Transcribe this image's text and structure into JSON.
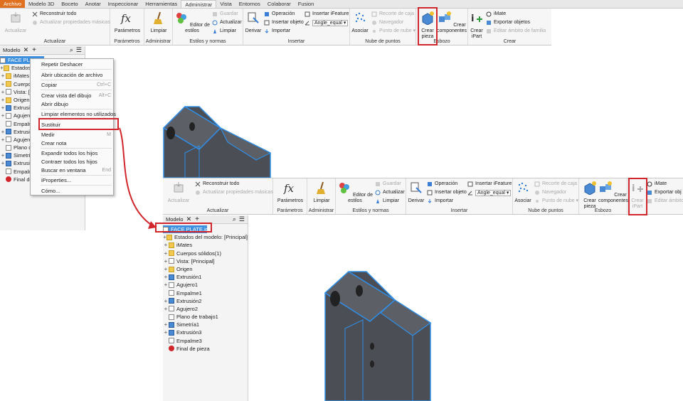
{
  "tabs": [
    "Archivo",
    "Modelo 3D",
    "Boceto",
    "Anotar",
    "Inspeccionar",
    "Herramientas",
    "Administrar",
    "Vista",
    "Entornos",
    "Colaborar",
    "Fusion"
  ],
  "top_ribbon": {
    "actualizar": "Actualizar",
    "reconstruir": "Reconstruir todo",
    "act_props": "Actualizar propiedades másicas",
    "group_actualizar": "Actualizar",
    "parametros": "Parámetros",
    "group_parametros": "Parámetros",
    "limpiar_big": "Limpiar",
    "group_administrar": "Administrar",
    "editor_estilos": "Editor de estilos",
    "guardar": "Guardar",
    "act_estilos": "Actualizar",
    "limpiar_sm": "Limpiar",
    "group_estilos": "Estilos y normas",
    "derivar": "Derivar",
    "operacion": "Operación",
    "insertar_objeto": "Insertar objeto",
    "importar": "Importar",
    "insertar_ifeature": "Insertar iFeature",
    "angle_sel": "Angle_equal",
    "group_insertar": "Insertar",
    "asociar": "Asociar",
    "recorte": "Recorte de caja",
    "navegador": "Navegador",
    "punto_nube": "Punto de nube",
    "group_nube": "Nube de puntos",
    "crear_pieza": "Crear pieza",
    "crear_componentes": "Crear componentes",
    "group_esbozo": "Esbozo",
    "crear_ipart": "Crear iPart",
    "imate": "iMate",
    "exportar": "Exportar objetos",
    "editar_ambito": "Editar ámbito de familia",
    "group_crear": "Crear"
  },
  "panel_top": {
    "tab": "Modelo",
    "items": [
      "FACE PLATE",
      "Estados del modelo: [Principal]",
      "iMates",
      "Cuerpos sólidos(1)",
      "Vista: [Principal]",
      "Origen",
      "Extrusión1",
      "Agujero1",
      "Empalme1",
      "Extrusión2",
      "Agujero2",
      "Plano de trabajo1",
      "Simetría1",
      "Extrusión3",
      "Empalme3",
      "Final de pieza"
    ]
  },
  "context_menu": {
    "items": [
      "Repetir Deshacer",
      "Abrir ubicación de archivo",
      "Copiar",
      "Crear vista del dibujo",
      "Abrir dibujo",
      "Limpiar elementos no utilizados",
      "Sustituir",
      "Medir",
      "Crear nota",
      "Expandir todos los hijos",
      "Contraer todos los hijos",
      "Buscar en ventana",
      "iProperties...",
      "Cómo..."
    ],
    "shortcuts": {
      "copy": "Ctrl+C",
      "view": "Alt+C",
      "measure": "M",
      "find": "End"
    }
  },
  "panel_bottom": {
    "tab": "Modelo",
    "items": [
      "FACE PLATE.ipt",
      "Estados del modelo: [Principal]",
      "iMates",
      "Cuerpos sólidos(1)",
      "Vista: [Principal]",
      "Origen",
      "Extrusión1",
      "Agujero1",
      "Empalme1",
      "Extrusión2",
      "Agujero2",
      "Plano de trabajo1",
      "Simetría1",
      "Extrusión3",
      "Empalme3",
      "Final de pieza"
    ]
  },
  "bottom_ribbon": {
    "exportar": "Exportar obj"
  },
  "colors": {
    "highlight": "#d0262c",
    "selection": "#3d8fe0",
    "accent_tab": "#e07020",
    "model": "#4b4e55",
    "edge": "#2f8fe8"
  }
}
